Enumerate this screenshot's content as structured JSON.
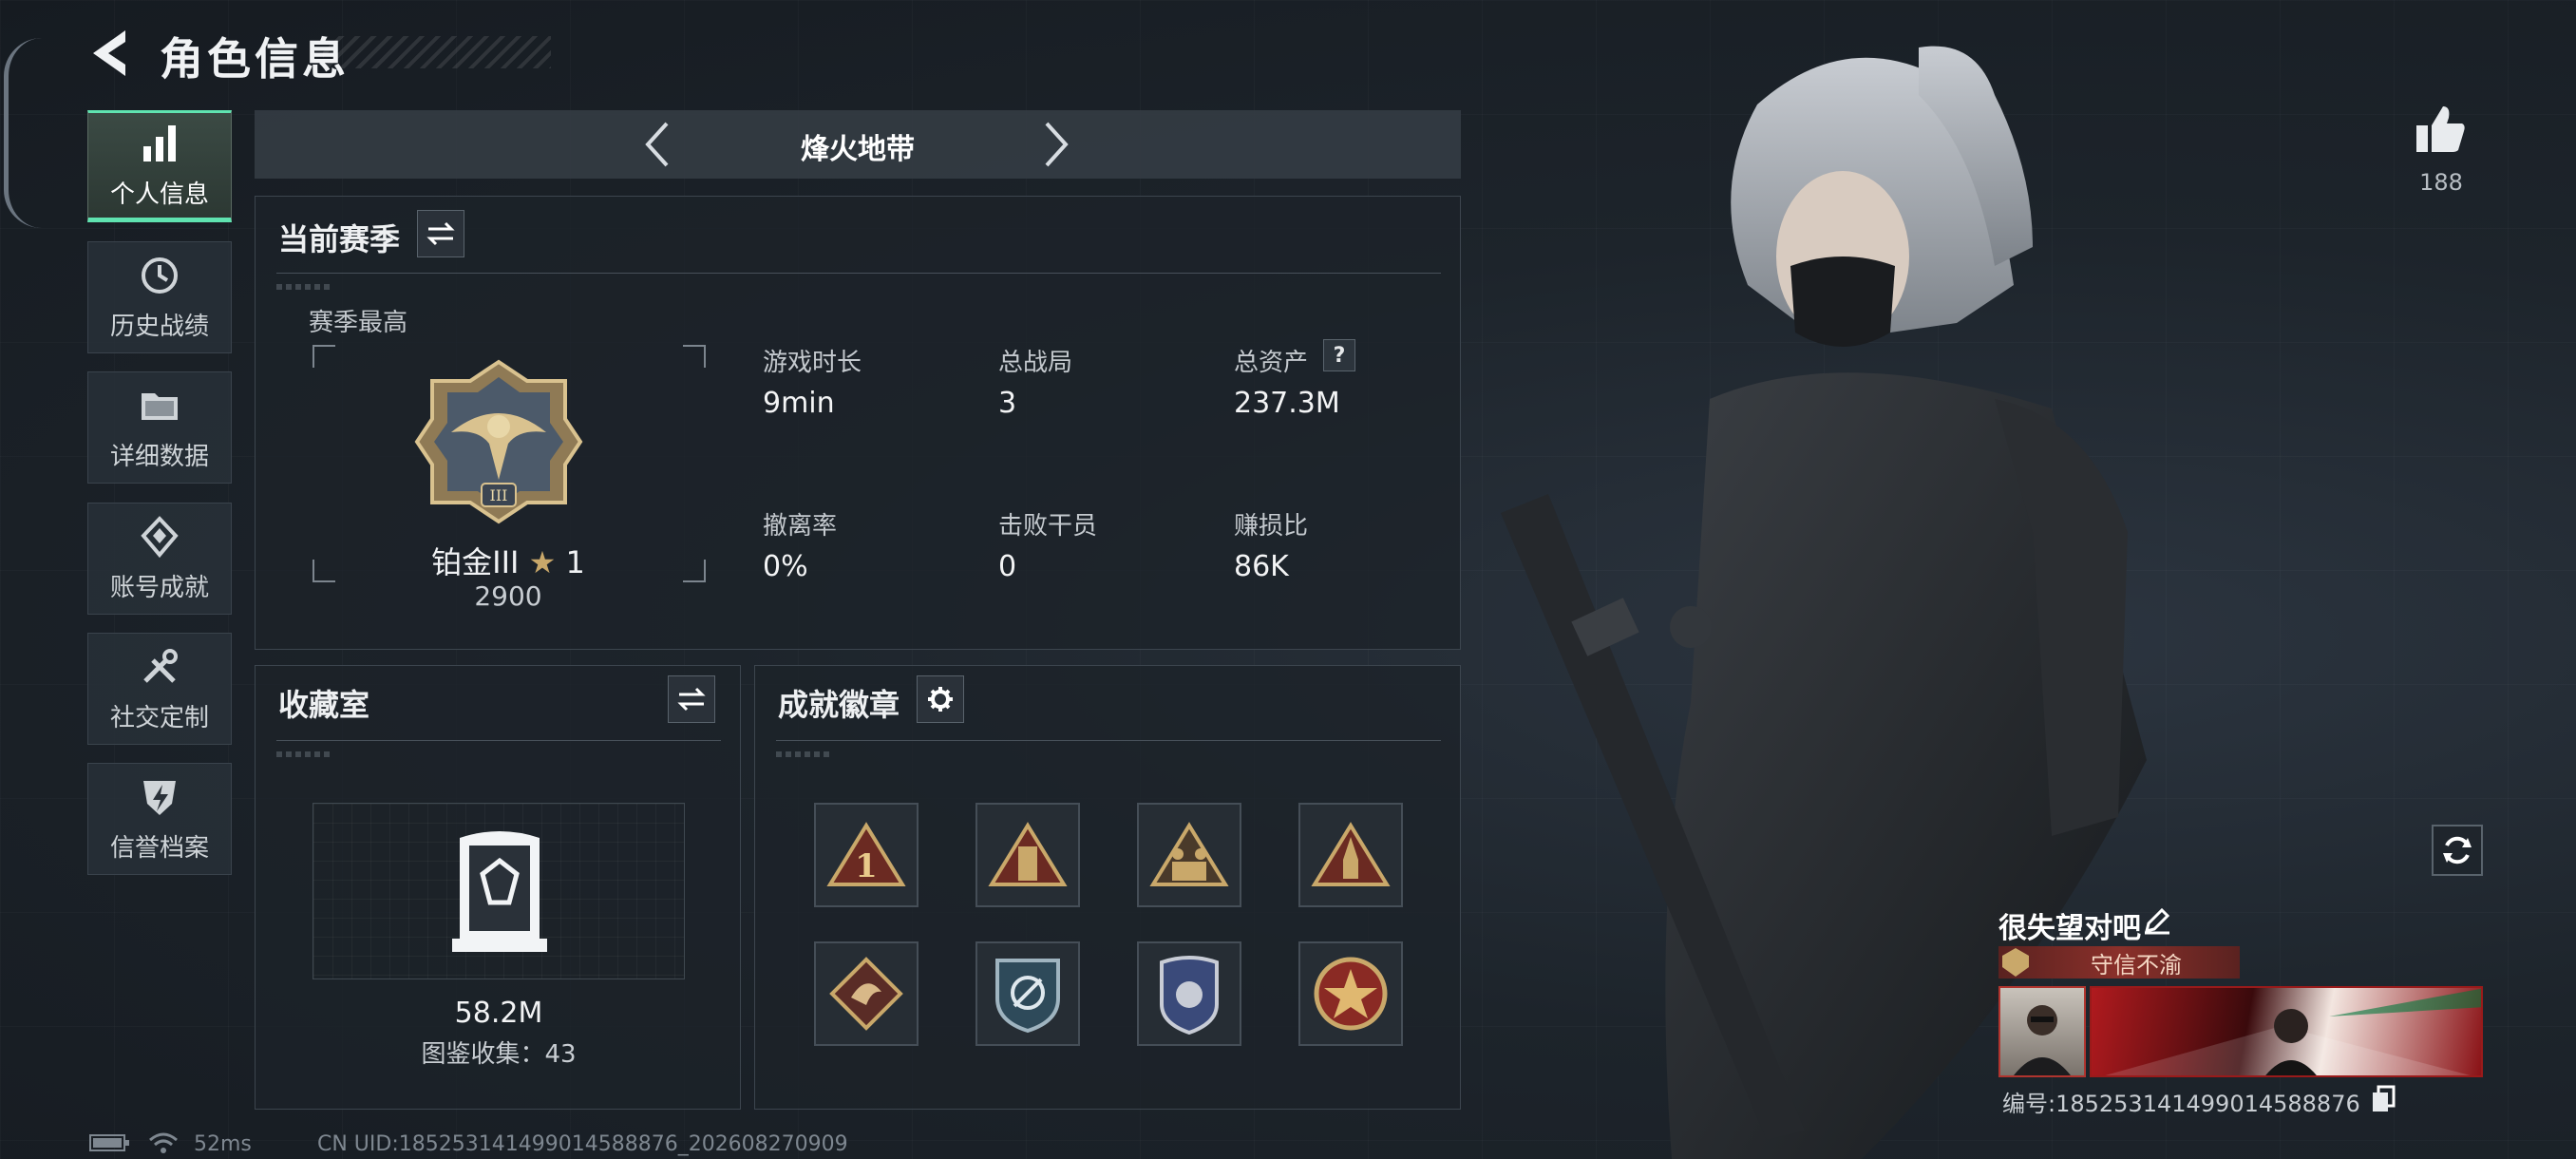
{
  "header": {
    "title": "角色信息"
  },
  "sidebar": {
    "items": [
      {
        "label": "个人信息",
        "icon": "bar-chart-icon",
        "active": true
      },
      {
        "label": "历史战绩",
        "icon": "history-clock-icon",
        "active": false
      },
      {
        "label": "详细数据",
        "icon": "folder-icon",
        "active": false
      },
      {
        "label": "账号成就",
        "icon": "achievement-diamond-icon",
        "active": false
      },
      {
        "label": "社交定制",
        "icon": "tools-icon",
        "active": false
      },
      {
        "label": "信誉档案",
        "icon": "credit-shield-icon",
        "active": false
      }
    ]
  },
  "mode_selector": {
    "title": "烽火地带"
  },
  "season": {
    "title": "当前赛季",
    "best_label": "赛季最高",
    "rank_name": "铂金III",
    "rank_stars": "1",
    "rank_score": "2900",
    "stats": [
      {
        "label": "游戏时长",
        "value": "9min"
      },
      {
        "label": "总战局",
        "value": "3"
      },
      {
        "label": "总资产",
        "value": "237.3M",
        "help": "?"
      },
      {
        "label": "撤离率",
        "value": "0%"
      },
      {
        "label": "击败干员",
        "value": "0"
      },
      {
        "label": "赚损比",
        "value": "86K"
      }
    ]
  },
  "collection": {
    "title": "收藏室",
    "value": "58.2M",
    "count_text": "图鉴收集：43"
  },
  "badges": {
    "title": "成就徽章",
    "items": [
      "badge-1",
      "badge-2",
      "badge-3",
      "badge-4",
      "badge-5",
      "badge-6",
      "badge-7",
      "badge-8"
    ]
  },
  "likes": {
    "count": "188"
  },
  "player": {
    "name": "很失望对吧",
    "honor_title": "守信不渝",
    "id_text": "编号:1852531414990145888​76"
  },
  "status_bar": {
    "ping": "52ms",
    "uid": "CN UID:1852531414990145888​76_202608270909"
  },
  "colors": {
    "accent": "#5fe3b0",
    "gold": "#c9a86a",
    "honor_bg": "#7a2a26"
  }
}
